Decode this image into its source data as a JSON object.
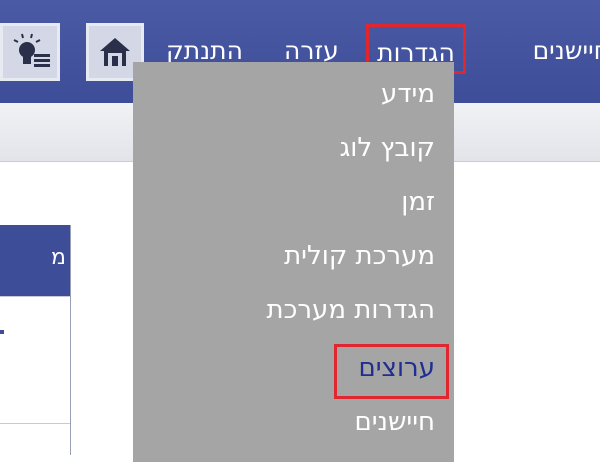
{
  "topbar": {
    "alerts_label": "חיישנים",
    "settings_label": "הגדרות",
    "help_label": "עזרה",
    "logout_label": "התנתק",
    "home_icon": "home-icon",
    "bulb_icon": "lightbulb-list-icon"
  },
  "settings_menu": {
    "items": [
      {
        "label": "מידע",
        "active": false
      },
      {
        "label": "קובץ לוג",
        "active": false
      },
      {
        "label": "זמן",
        "active": false
      },
      {
        "label": "מערכת קולית",
        "active": false
      },
      {
        "label": "הגדרות מערכת",
        "active": false
      },
      {
        "label": "ערוצים",
        "active": true
      },
      {
        "label": "חיישנים",
        "active": false
      }
    ]
  },
  "colors": {
    "bar": "#3e4d97",
    "menu": "#a5a5a5",
    "highlight": "#e0262e",
    "active_text": "#1f2e8f"
  }
}
